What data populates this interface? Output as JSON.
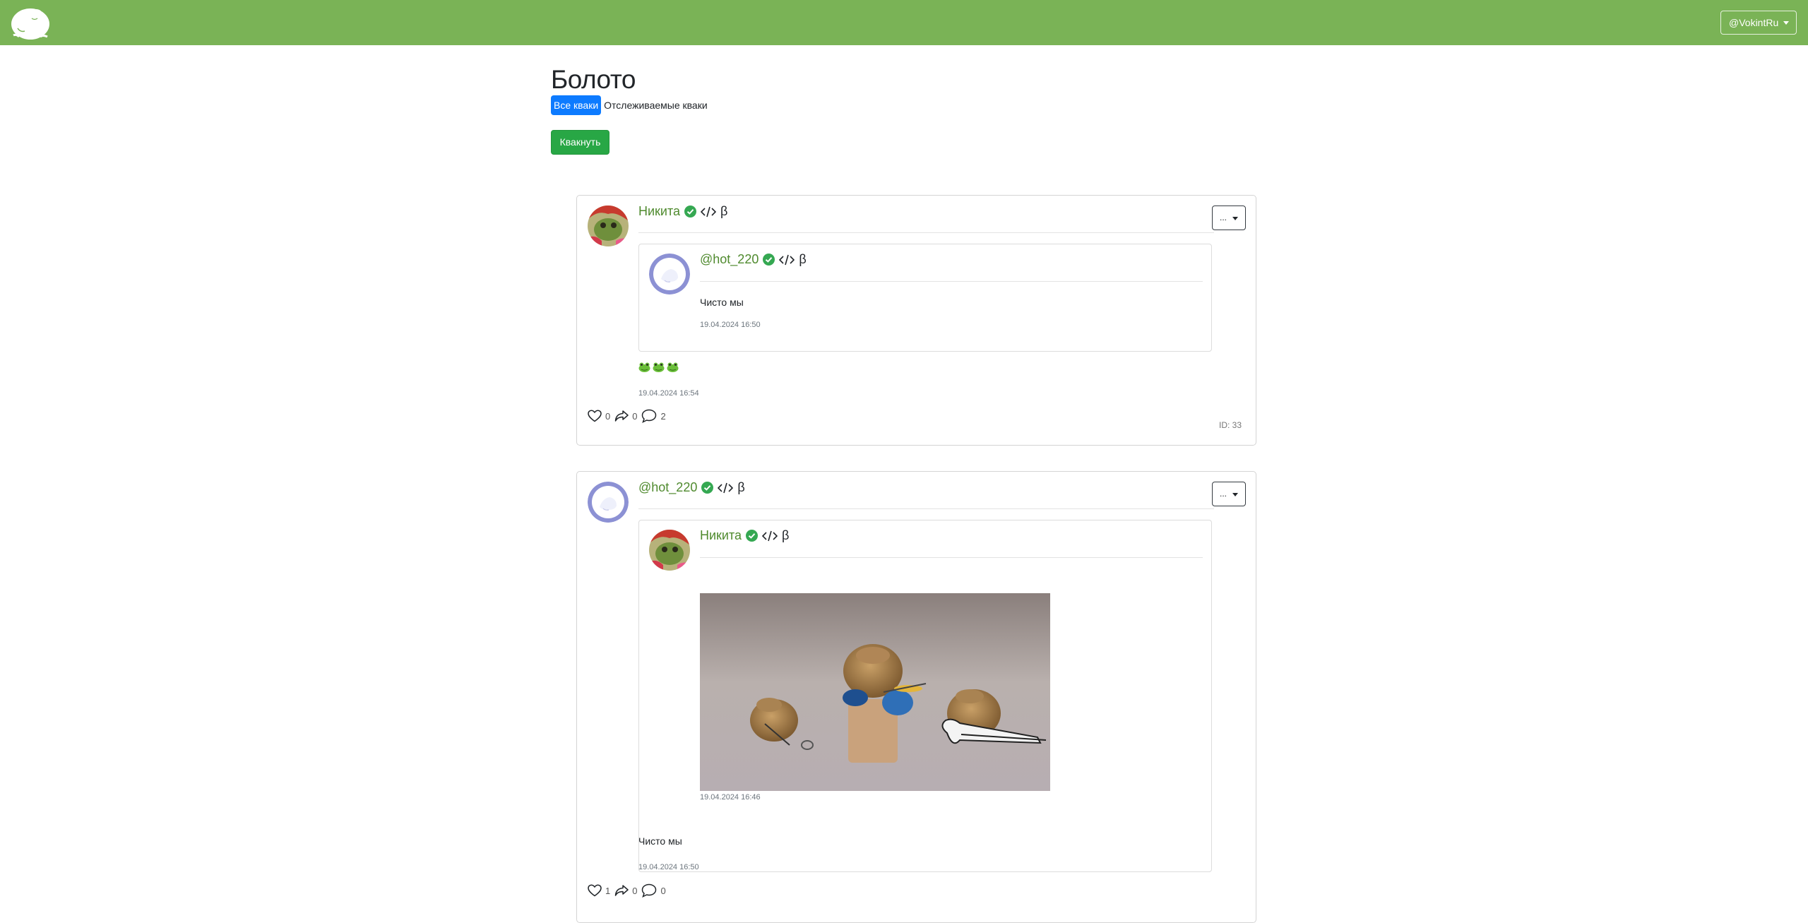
{
  "navbar": {
    "user_label": "@VokintRu"
  },
  "header": {
    "title": "Болото",
    "tabs": [
      {
        "label": "Все кваки",
        "active": true
      },
      {
        "label": "Отслеживаемые кваки",
        "active": false
      }
    ],
    "kvak_button": "Квакнуть"
  },
  "colors": {
    "navbar": "#7ab356",
    "accent_blue": "#0d7bff",
    "accent_green": "#28a745",
    "author_green": "#4f8a2e"
  },
  "posts": [
    {
      "author": "Никита",
      "beta": "β",
      "menu_label": "...",
      "quoted": {
        "author": "@hot_220",
        "beta": "β",
        "text": "Чисто мы",
        "time": "19.04.2024 16:50"
      },
      "time": "19.04.2024 16:54",
      "likes": "0",
      "reposts": "0",
      "comments": "2",
      "id_label": "ID: 33"
    },
    {
      "author": "@hot_220",
      "beta": "β",
      "menu_label": "...",
      "quoted": {
        "author": "Никита",
        "beta": "β",
        "image": "frog-band-photo",
        "time": "19.04.2024 16:46"
      },
      "text": "Чисто мы",
      "time": "19.04.2024 16:50",
      "likes": "1",
      "reposts": "0",
      "comments": "0"
    }
  ]
}
